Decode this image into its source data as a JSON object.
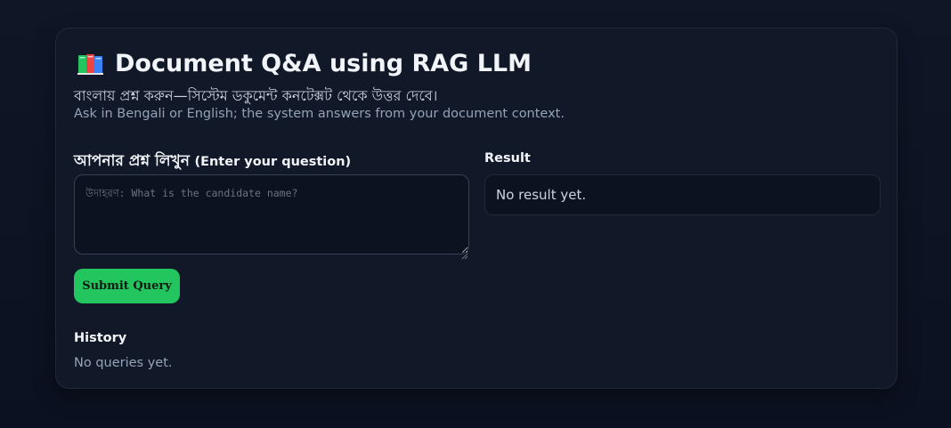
{
  "header": {
    "icon": "books-icon",
    "title": "Document Q&A using RAG LLM",
    "subtitle_bn": "বাংলায় প্রশ্ন করুন—সিস্টেম ডকুমেন্ট কনটেক্সট থেকে উত্তর দেবে।",
    "subtitle_en": "Ask in Bengali or English; the system answers from your document context."
  },
  "question": {
    "label_bn": "আপনার প্রশ্ন লিখুন",
    "label_en": "(Enter your question)",
    "value": "",
    "placeholder": "উদাহরণ: What is the candidate name?"
  },
  "submit": {
    "label": "Submit Query"
  },
  "result": {
    "label": "Result",
    "text": "No result yet."
  },
  "history": {
    "label": "History",
    "empty_text": "No queries yet."
  },
  "colors": {
    "background": "#0b1120",
    "card": "#111827",
    "accent": "#22c55e"
  }
}
